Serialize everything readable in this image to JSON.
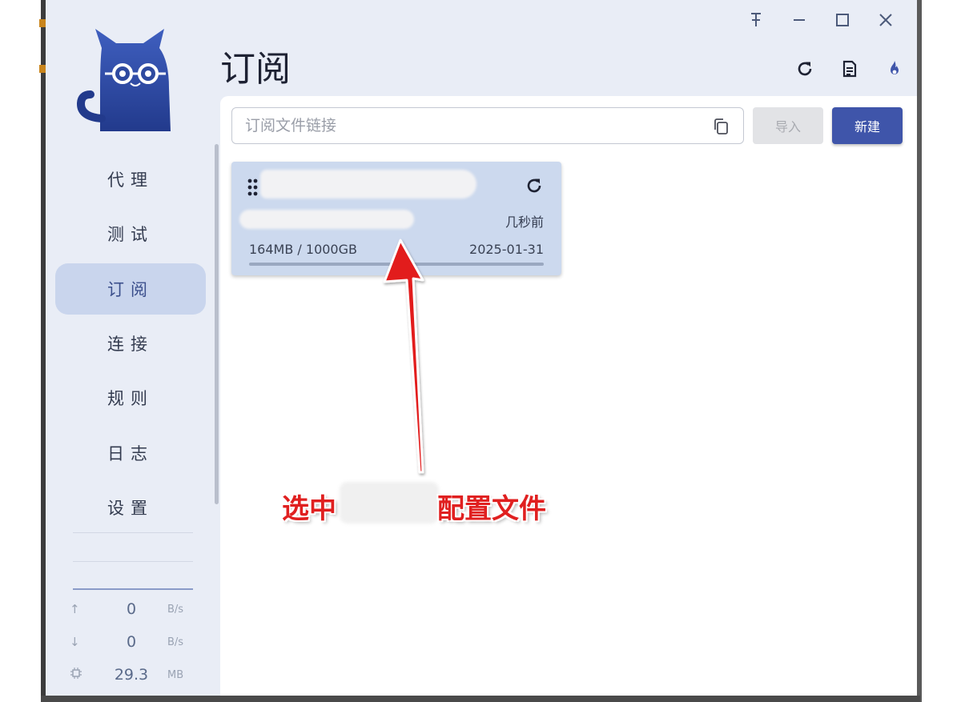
{
  "window": {
    "controls": {
      "pin_icon": "pin-icon",
      "minimize_icon": "minimize-icon",
      "maximize_icon": "maximize-icon",
      "close_icon": "close-icon"
    }
  },
  "sidebar": {
    "logo_icon": "cat-logo-icon",
    "items": [
      {
        "label": "代理",
        "active": false
      },
      {
        "label": "测试",
        "active": false
      },
      {
        "label": "订阅",
        "active": true
      },
      {
        "label": "连接",
        "active": false
      },
      {
        "label": "规则",
        "active": false
      },
      {
        "label": "日志",
        "active": false
      },
      {
        "label": "设置",
        "active": false
      }
    ],
    "traffic": {
      "upload": {
        "value": "0",
        "unit": "B/s",
        "icon": "arrow-up-icon"
      },
      "download": {
        "value": "0",
        "unit": "B/s",
        "icon": "arrow-down-icon"
      },
      "memory": {
        "value": "29.3",
        "unit": "MB",
        "icon": "chip-icon"
      }
    }
  },
  "header": {
    "title": "订阅",
    "actions": [
      "refresh-icon",
      "document-icon",
      "flame-icon"
    ]
  },
  "toolbar": {
    "url_placeholder": "订阅文件链接",
    "import_label": "导入",
    "new_label": "新建"
  },
  "profile_card": {
    "updated": "几秒前",
    "usage": "164MB / 1000GB",
    "expire": "2025-01-31",
    "usage_fraction": 0.0002
  },
  "annotation": {
    "text_before": "选中",
    "text_after": "配置文件"
  },
  "colors": {
    "accent": "#3f55aa",
    "sidebar_bg": "#e9edf6",
    "active_nav_bg": "#c9d5ed",
    "card_bg": "#ccd9ee",
    "annotation_red": "#e02020"
  }
}
